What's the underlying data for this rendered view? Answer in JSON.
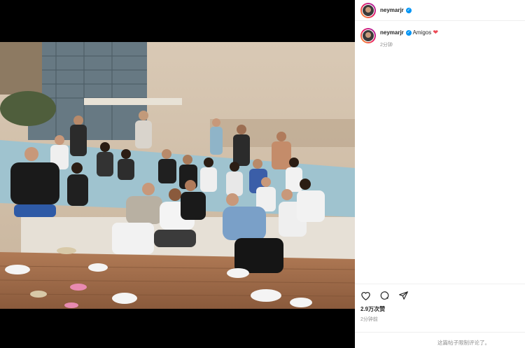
{
  "post": {
    "username": "neymarjr",
    "caption_text": "Amigos",
    "caption_time": "2分钟",
    "likes": "2.9万次赞",
    "post_time": "2分钟前",
    "comments_disabled": "这篇帖子限制评论了。"
  },
  "icons": {
    "verified": "verified-badge-icon",
    "caption_emoji": "red-heart-icon",
    "actions": [
      "heart-icon",
      "comment-icon",
      "share-icon"
    ]
  },
  "colors": {
    "verified_blue": "#0095f6",
    "heart_red": "#ed4956",
    "muted_text": "#8e8e8e"
  }
}
